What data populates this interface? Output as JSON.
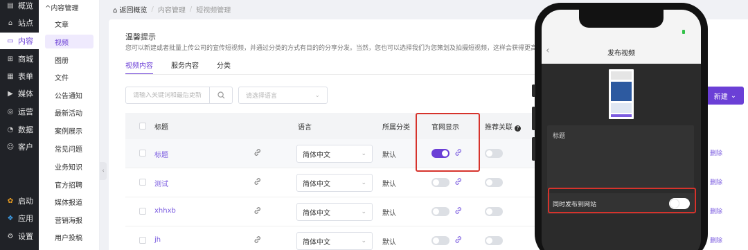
{
  "primary_nav": [
    {
      "label": "概览",
      "icon": "overview-icon",
      "glyph": "▤"
    },
    {
      "label": "站点",
      "icon": "home-icon",
      "glyph": "⌂"
    },
    {
      "label": "内容",
      "icon": "document-icon",
      "glyph": "▭",
      "active": true
    },
    {
      "label": "商城",
      "icon": "shop-icon",
      "glyph": "⊞"
    },
    {
      "label": "表单",
      "icon": "form-icon",
      "glyph": "▦"
    },
    {
      "label": "媒体",
      "icon": "media-icon",
      "glyph": "▶"
    },
    {
      "label": "运营",
      "icon": "operation-icon",
      "glyph": "◎"
    },
    {
      "label": "数据",
      "icon": "data-icon",
      "glyph": "◔"
    },
    {
      "label": "客户",
      "icon": "user-icon",
      "glyph": "☺"
    },
    {
      "label": "启动",
      "icon": "launch-icon",
      "glyph": "✿"
    },
    {
      "label": "应用",
      "icon": "apps-icon",
      "glyph": "❖"
    },
    {
      "label": "设置",
      "icon": "settings-icon",
      "glyph": "⚙"
    }
  ],
  "secondary_nav": {
    "header": "^内容管理",
    "items": [
      {
        "label": "文章"
      },
      {
        "label": "视频",
        "active": true
      },
      {
        "label": "图册"
      },
      {
        "label": "文件"
      },
      {
        "label": "公告通知"
      },
      {
        "label": "最新活动"
      },
      {
        "label": "案例展示"
      },
      {
        "label": "常见问题"
      },
      {
        "label": "业务知识"
      },
      {
        "label": "官方招聘"
      },
      {
        "label": "媒体报道"
      },
      {
        "label": "营销海报"
      },
      {
        "label": "用户投稿"
      }
    ]
  },
  "breadcrumb": {
    "back": "返回概览",
    "items": [
      "内容管理",
      "短视频管理"
    ]
  },
  "tip": {
    "title": "温馨提示",
    "text": "您可以新建或者批量上传公司的宣传短视频，并通过分类的方式有目的的分享分发。当然，您也可以选择我们为您策划及拍摄短视频，这样会获得更高"
  },
  "tabs": [
    {
      "label": "视频内容",
      "active": true
    },
    {
      "label": "服务内容"
    },
    {
      "label": "分类"
    }
  ],
  "filters": {
    "search_placeholder": "请输入关键词和最后更新",
    "language_placeholder": "请选择语言"
  },
  "new_button": "新建",
  "table": {
    "headers": {
      "title": "标题",
      "language": "语言",
      "category": "所属分类",
      "site_display": "官网显示",
      "related": "推荐关联"
    },
    "rows": [
      {
        "title": "标题",
        "language": "简体中文",
        "category": "默认",
        "site_display": true,
        "delete": "删除"
      },
      {
        "title": "测试",
        "language": "简体中文",
        "category": "默认",
        "site_display": false,
        "delete": "删除"
      },
      {
        "title": "xhhxb",
        "language": "简体中文",
        "category": "默认",
        "site_display": false,
        "delete": "删除"
      },
      {
        "title": "jh",
        "language": "简体中文",
        "category": "默认",
        "site_display": false,
        "delete": "删除"
      }
    ]
  },
  "phone": {
    "title": "发布视频",
    "field_label": "标题",
    "publish_label": "同时发布到网站",
    "publish_on": false
  },
  "colors": {
    "accent": "#6b3fd6",
    "highlight": "#d6332c",
    "sidebar": "#202227"
  }
}
